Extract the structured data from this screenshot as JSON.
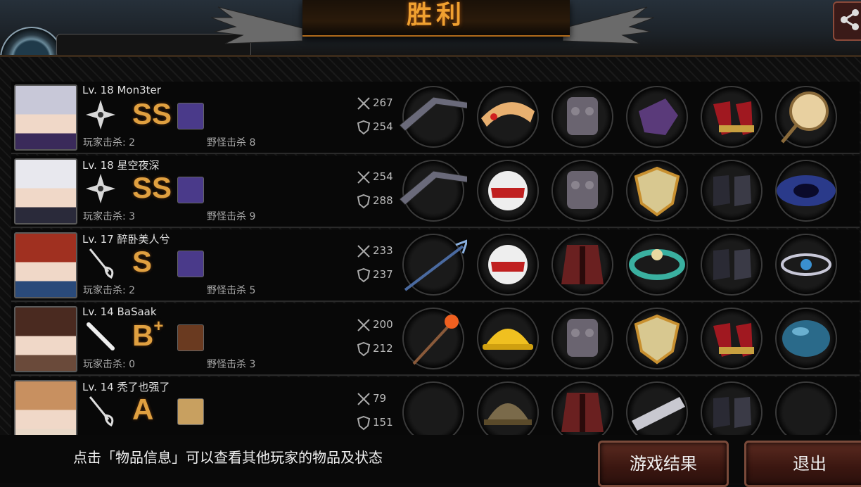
{
  "header": {
    "title": "胜利",
    "player_name": "Mon3ter"
  },
  "players": [
    {
      "level": "Lv. 18",
      "name": "Mon3ter",
      "role_icon": "shuriken-icon",
      "rank": "SS",
      "rank_plus": "",
      "atk": "267",
      "def": "254",
      "player_kills": "玩家击杀: 2",
      "monster_kills": "野怪击杀 8",
      "items": [
        "boomerang-icon",
        "tiara-icon",
        "armor-icon",
        "gauntlet-icon",
        "heels-icon",
        "mirror-icon"
      ]
    },
    {
      "level": "Lv. 18",
      "name": "星空夜深",
      "role_icon": "shuriken-icon",
      "rank": "SS",
      "rank_plus": "",
      "atk": "254",
      "def": "288",
      "player_kills": "玩家击杀: 3",
      "monster_kills": "野怪击杀 9",
      "items": [
        "boomerang-icon",
        "helmet-icon",
        "armor-icon",
        "shield-icon",
        "boots-icon",
        "galaxy-icon"
      ]
    },
    {
      "level": "Lv. 17",
      "name": "醉卧美人兮",
      "role_icon": "rapier-icon",
      "rank": "S",
      "rank_plus": "",
      "atk": "233",
      "def": "237",
      "player_kills": "玩家击杀: 2",
      "monster_kills": "野怪击杀 5",
      "items": [
        "trident-icon",
        "helmet-icon",
        "coat-icon",
        "bracelet-icon",
        "boots-icon",
        "ring-icon"
      ]
    },
    {
      "level": "Lv. 14",
      "name": "BaSaak",
      "role_icon": "bat-icon",
      "rank": "B",
      "rank_plus": "+",
      "atk": "200",
      "def": "212",
      "player_kills": "玩家击杀: 0",
      "monster_kills": "野怪击杀 3",
      "items": [
        "torch-icon",
        "hardhat-icon",
        "armor-icon",
        "shield-icon",
        "heels-icon",
        "orb-icon"
      ]
    },
    {
      "level": "Lv. 14",
      "name": "秃了也强了",
      "role_icon": "rapier-icon",
      "rank": "A",
      "rank_plus": "",
      "atk": "79",
      "def": "151",
      "player_kills": "",
      "monster_kills": "",
      "items": [
        "empty",
        "army-helmet-icon",
        "coat-icon",
        "bracer-icon",
        "boots-icon",
        "empty"
      ]
    }
  ],
  "footer": {
    "hint": "点击「物品信息」可以查看其他玩家的物品及状态",
    "result_button": "游戏结果",
    "quit_button": "退出"
  },
  "colors": {
    "accent": "#f0a030",
    "rank": "#e0a040",
    "button": "#5a2a20"
  }
}
